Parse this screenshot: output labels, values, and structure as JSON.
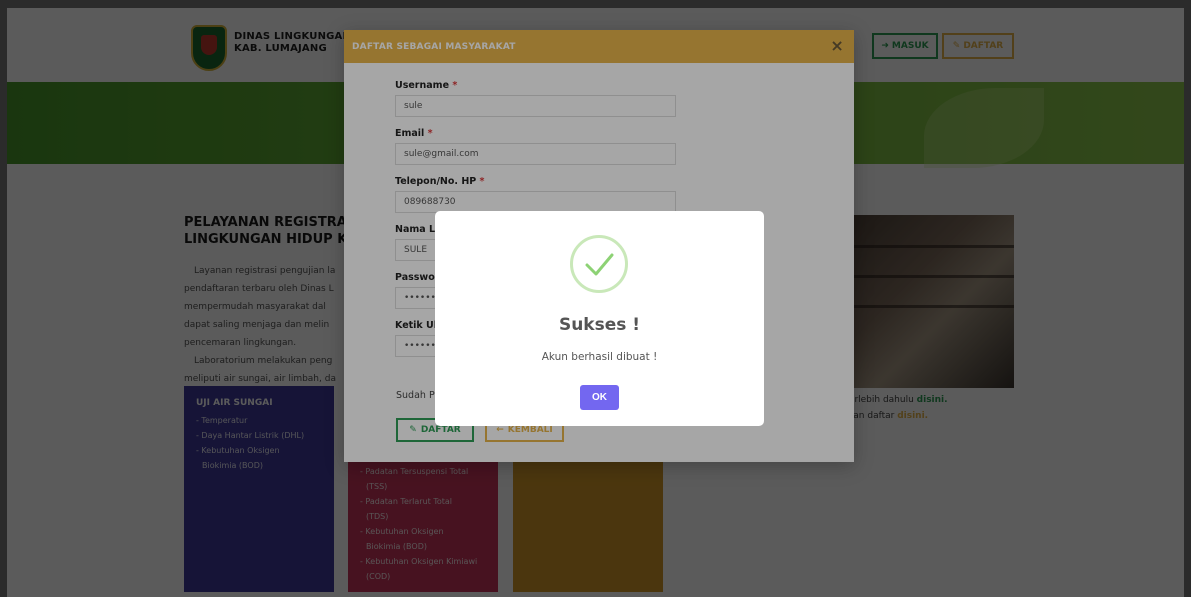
{
  "header": {
    "brand_line1": "DINAS LINGKUNGAN HI",
    "brand_line2": "KAB. LUMAJANG",
    "masuk_label": "MASUK",
    "daftar_label": "DAFTAR"
  },
  "main": {
    "title_line1": "PELAYANAN REGISTRASI U",
    "title_line2": "LINGKUNGAN HIDUP KABU",
    "para": [
      "Layanan registrasi pengujian la",
      "pendaftaran terbaru oleh Dinas L",
      "mempermudah masyarakat dal",
      "dapat saling menjaga dan melin",
      "pencemaran lingkungan.",
      "Laboratorium melakukan peng",
      "meliputi air sungai, air limbah, da"
    ],
    "card_blue": {
      "title": "UJI AIR SUNGAI",
      "items": [
        "- Temperatur",
        "- Daya Hantar Listrik (DHL)",
        "- Kebutuhan Oksigen",
        "  Biokimia (BOD)"
      ]
    },
    "card_pink": {
      "items": [
        "- Padatan Tersuspensi Total",
        "  (TSS)",
        "- Padatan Terlarut Total",
        "  (TDS)",
        "- Kebutuhan Oksigen",
        "  Biokimia (BOD)",
        "- Kebutuhan Oksigen Kimiawi",
        "  (COD)"
      ]
    },
    "side_note": {
      "line1_prefix": "a terlebih dahulu ",
      "line1_link": "disini.",
      "line2_prefix": "ahkan daftar ",
      "line2_link": "disini."
    }
  },
  "register_modal": {
    "title": "DAFTAR SEBAGAI MASYARAKAT",
    "close_symbol": "×",
    "fields": {
      "username_label": "Username",
      "username_value": "sule",
      "email_label": "Email",
      "email_value": "sule@gmail.com",
      "phone_label": "Telepon/No. HP",
      "phone_value": "089688730",
      "name_label": "Nama Le",
      "name_value": "SULE",
      "password_label": "Passwo",
      "password_value": "••••••",
      "repeat_label": "Ketik Ul",
      "repeat_value": "••••••"
    },
    "required_mark": "*",
    "footer_text": "Sudah P",
    "daftar_label": "DAFTAR",
    "kembali_label": "KEMBALI"
  },
  "alert": {
    "title": "Sukses !",
    "message": "Akun berhasil dibuat !",
    "ok_label": "OK"
  },
  "colors": {
    "green": "#2e9d57",
    "yellow": "#e6b44a",
    "ok_button": "#7367f0"
  }
}
